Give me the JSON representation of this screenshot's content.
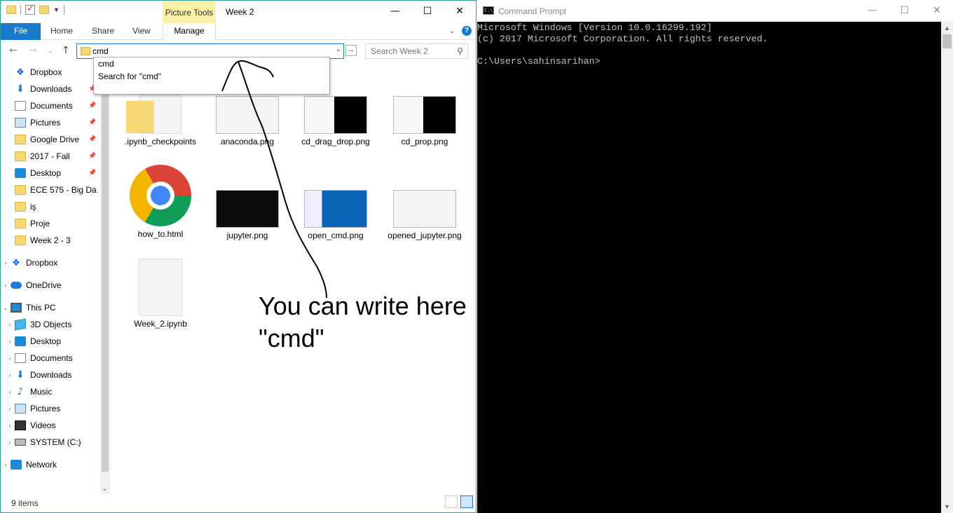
{
  "explorer": {
    "title": "Week 2",
    "contextual_tab_group": "Picture Tools",
    "ribbon_tabs": {
      "file": "File",
      "home": "Home",
      "share": "Share",
      "view": "View",
      "manage": "Manage"
    },
    "window_buttons": {
      "minimize": "—",
      "maximize": "☐",
      "close": "✕"
    },
    "address_value": "cmd",
    "search_placeholder": "Search Week 2",
    "autocomplete": [
      "cmd",
      "Search for \"cmd\""
    ],
    "sidebar": {
      "quick_access": [
        {
          "label": "Dropbox",
          "icon": "dropbox-icon",
          "pinned": false
        },
        {
          "label": "Downloads",
          "icon": "download-icon",
          "pinned": true
        },
        {
          "label": "Documents",
          "icon": "documents-icon",
          "pinned": true
        },
        {
          "label": "Pictures",
          "icon": "pictures-icon",
          "pinned": true
        },
        {
          "label": "Google Drive",
          "icon": "folder-icon",
          "pinned": true
        },
        {
          "label": "2017 - Fall",
          "icon": "folder-icon",
          "pinned": true
        },
        {
          "label": "Desktop",
          "icon": "desktop-icon",
          "pinned": true
        },
        {
          "label": "ECE 575 - Big Da",
          "icon": "folder-icon",
          "pinned": false
        },
        {
          "label": "iş",
          "icon": "folder-icon",
          "pinned": false
        },
        {
          "label": "Proje",
          "icon": "folder-icon",
          "pinned": false
        },
        {
          "label": "Week 2 - 3",
          "icon": "folder-icon",
          "pinned": false
        }
      ],
      "roots": {
        "dropbox": "Dropbox",
        "onedrive": "OneDrive",
        "this_pc": "This PC",
        "network": "Network"
      },
      "this_pc_items": [
        {
          "label": "3D Objects",
          "icon": "3d-objects-icon"
        },
        {
          "label": "Desktop",
          "icon": "desktop-icon"
        },
        {
          "label": "Documents",
          "icon": "documents-icon"
        },
        {
          "label": "Downloads",
          "icon": "download-icon"
        },
        {
          "label": "Music",
          "icon": "music-icon"
        },
        {
          "label": "Pictures",
          "icon": "pictures-icon"
        },
        {
          "label": "Videos",
          "icon": "videos-icon"
        },
        {
          "label": "SYSTEM (C:)",
          "icon": "drive-icon"
        }
      ]
    },
    "files": [
      {
        "name": ".ipynb_checkpoints",
        "thumb": "folder"
      },
      {
        "name": "anaconda.png",
        "thumb": "light"
      },
      {
        "name": "cd_drag_drop.png",
        "thumb": "mixed"
      },
      {
        "name": "cd_prop.png",
        "thumb": "mixed"
      },
      {
        "name": "how_to.html",
        "thumb": "chrome"
      },
      {
        "name": "jupyter.png",
        "thumb": "dark"
      },
      {
        "name": "open_cmd.png",
        "thumb": "blue"
      },
      {
        "name": "opened_jupyter.png",
        "thumb": "light"
      },
      {
        "name": "Week_2.ipynb",
        "thumb": "file"
      }
    ],
    "status_count": "9 items"
  },
  "annotation": {
    "line1": "You can write here",
    "line2": "\"cmd\""
  },
  "cmd": {
    "title": "Command Prompt",
    "icon_text": "C:\\",
    "window_buttons": {
      "minimize": "—",
      "maximize": "☐",
      "close": "✕"
    },
    "lines": [
      "Microsoft Windows [Version 10.0.16299.192]",
      "(c) 2017 Microsoft Corporation. All rights reserved.",
      "",
      "C:\\Users\\sahinsarihan>"
    ]
  },
  "colors": {
    "accent": "#1979ca",
    "picture_tools": "#fbf1a9",
    "console_bg": "#000000",
    "console_fg": "#c0c0c0"
  }
}
